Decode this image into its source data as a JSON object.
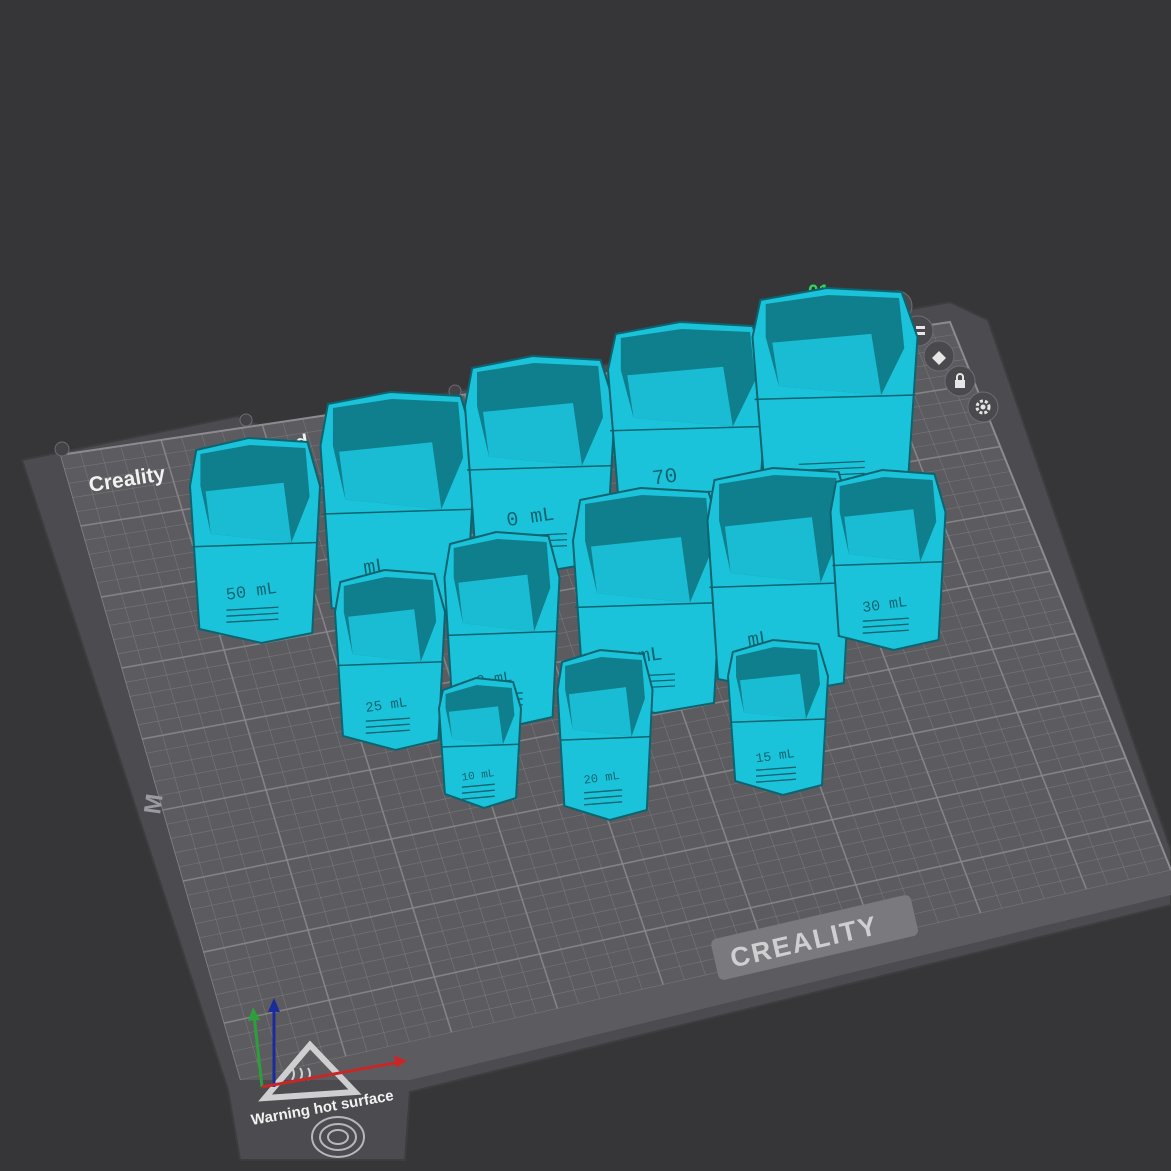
{
  "plate": {
    "index_label": "01",
    "brand_label": "Creality",
    "brand_label_suffix": "ed",
    "logo_text": "CREALITY",
    "side_mark": "M",
    "warning_text": "Warning hot surface"
  },
  "plate_tools": [
    {
      "icon": "close-icon"
    },
    {
      "icon": "list-icon"
    },
    {
      "icon": "auto-arrange-icon"
    },
    {
      "icon": "lock-icon"
    },
    {
      "icon": "gear-icon"
    }
  ],
  "cups": [
    {
      "label": "50 mL"
    },
    {
      "label": "mL"
    },
    {
      "label": "0 mL"
    },
    {
      "label": "70"
    },
    {
      "label": ""
    },
    {
      "label": "25 mL"
    },
    {
      "label": "0 mL"
    },
    {
      "label": "0 mL"
    },
    {
      "label": "mL"
    },
    {
      "label": "30 mL"
    },
    {
      "label": "10 mL"
    },
    {
      "label": "20 mL"
    },
    {
      "label": "15 mL"
    }
  ],
  "colors": {
    "background": "#363638",
    "plate": "#4c4c50",
    "plate_surface": "#5c5c60",
    "grid_line": "#8a8a8e",
    "model": "#1bc3da",
    "model_dark": "#0f7f8d",
    "model_edge": "#0c6470",
    "index_label": "#2fd45c",
    "axis_x": "#c62828",
    "axis_y": "#2e9e3a",
    "axis_z": "#1a2b9c"
  }
}
